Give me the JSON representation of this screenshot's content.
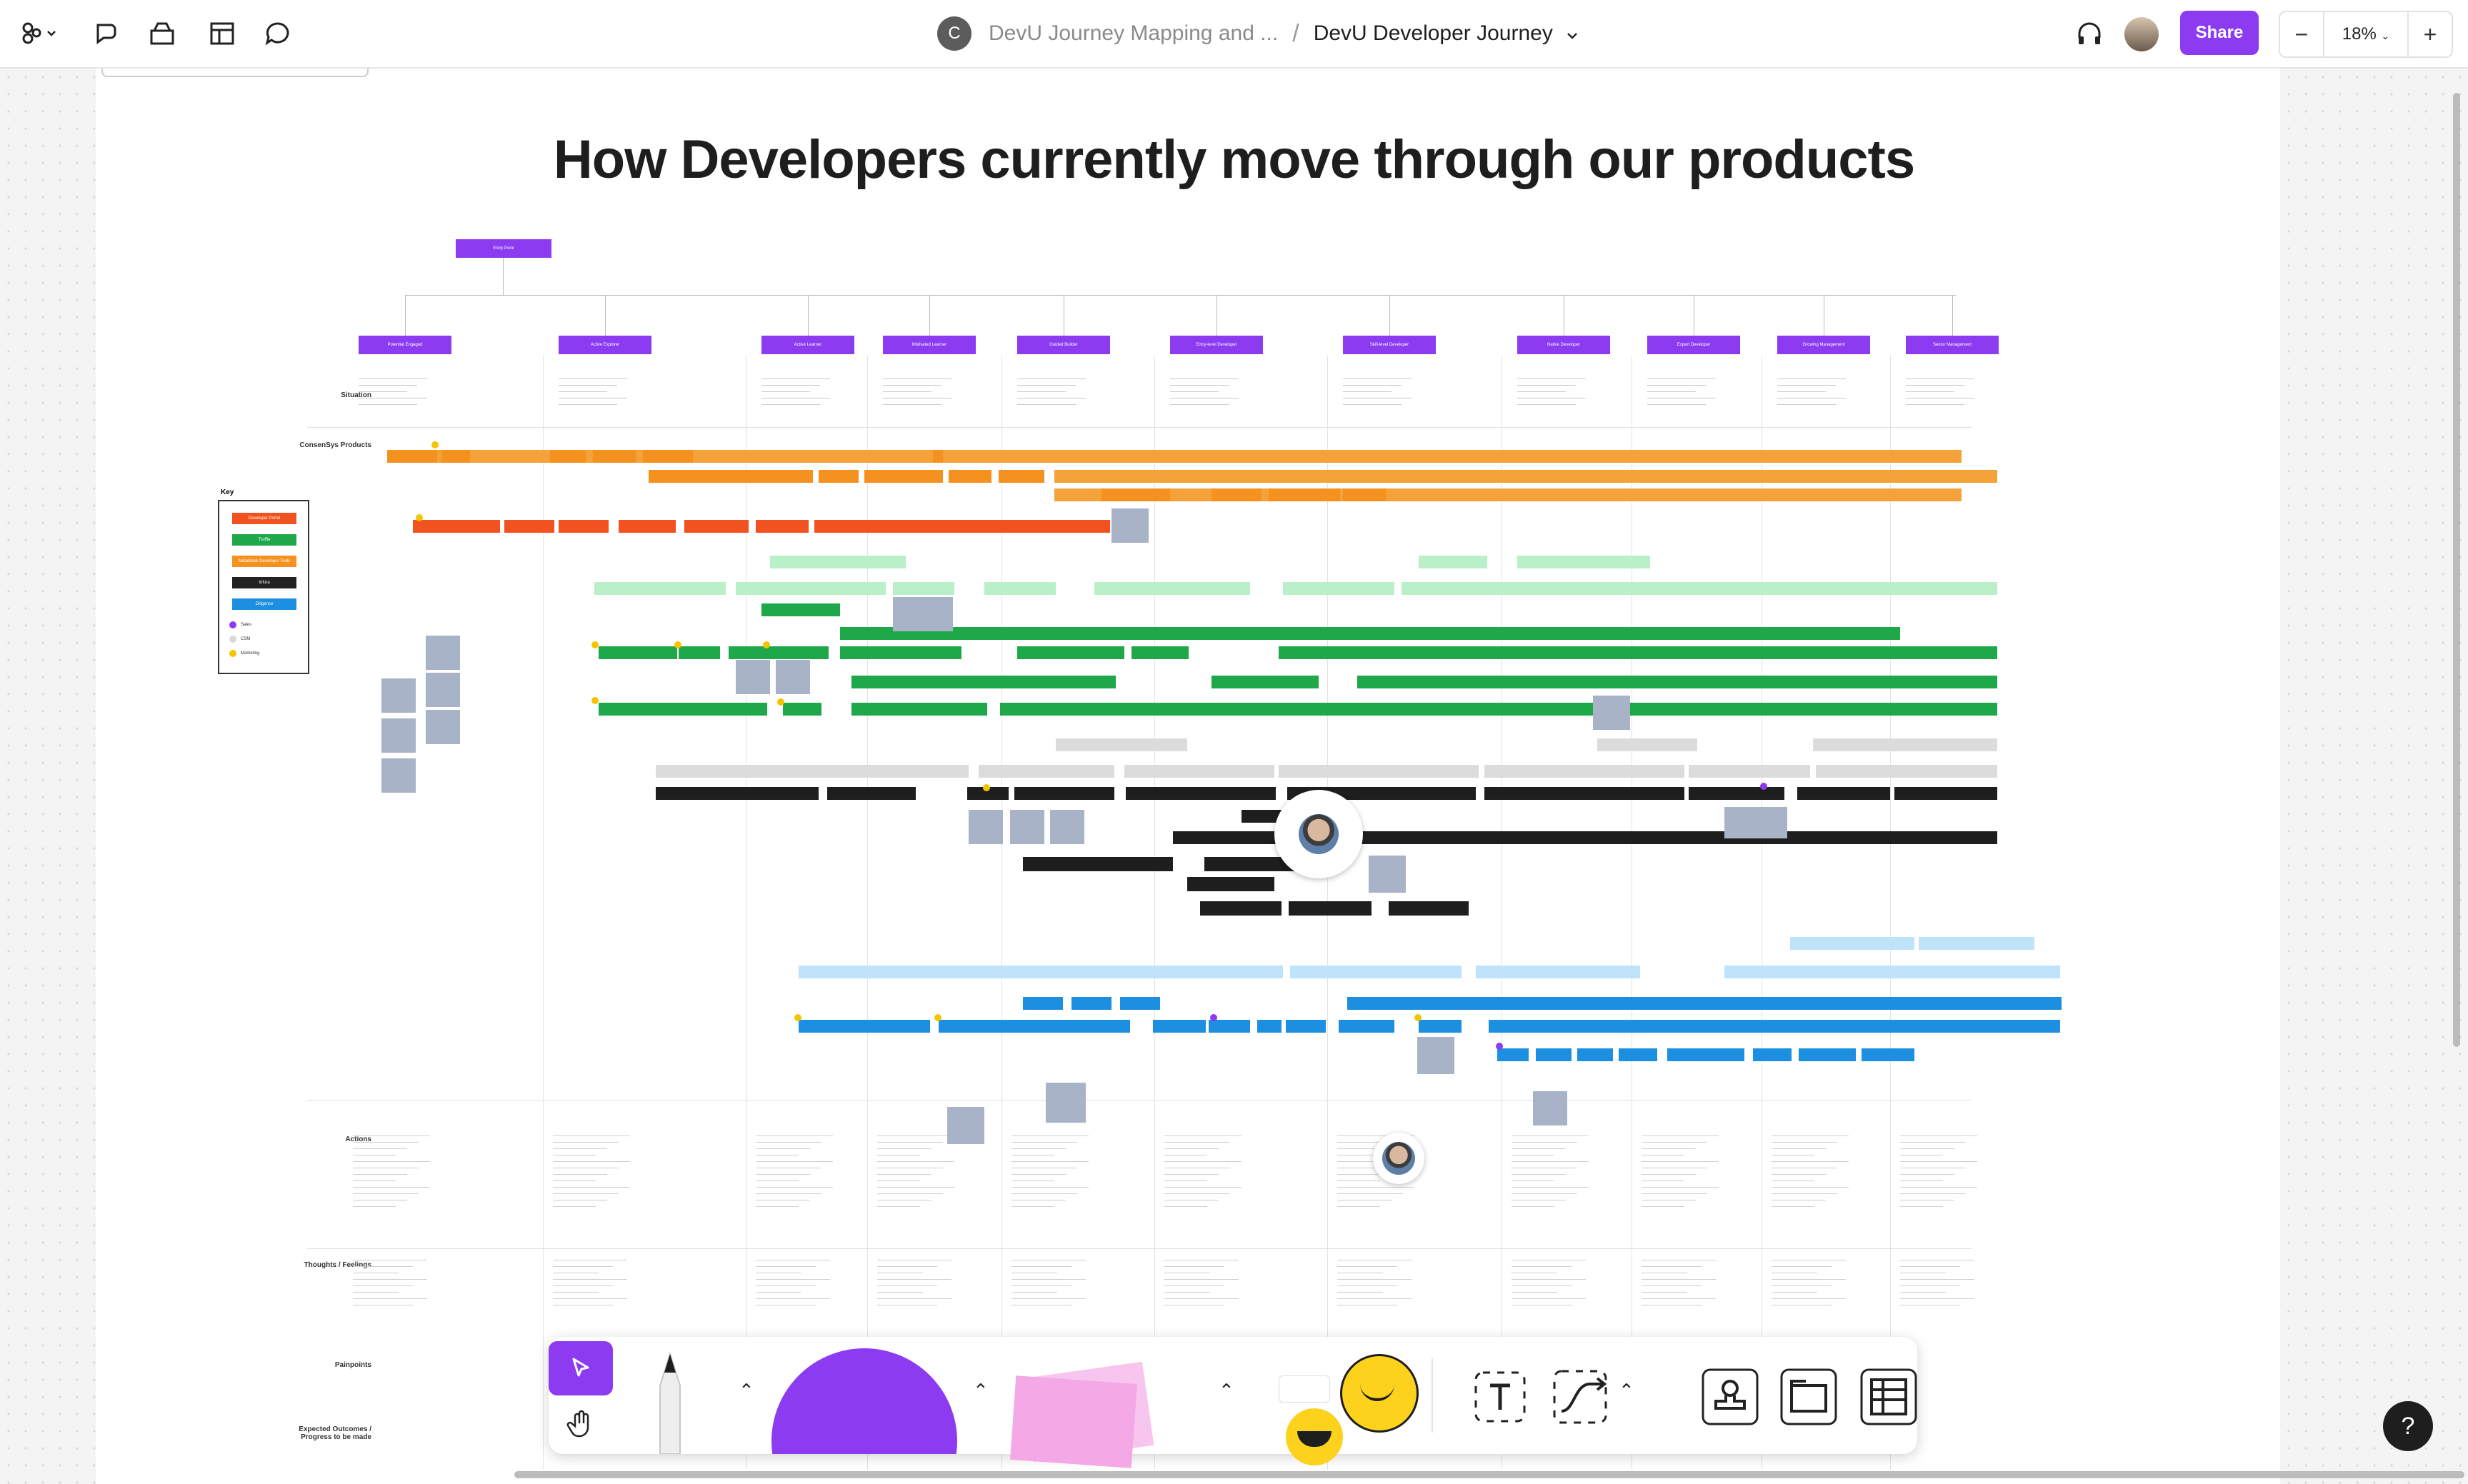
{
  "app": {
    "board_owner_initial": "C",
    "project_name": "DevU Journey Mapping and ...",
    "board_title": "DevU Developer Journey",
    "share_label": "Share",
    "zoom": "18%",
    "zoom_out": "−",
    "zoom_in": "+",
    "help": "?"
  },
  "board": {
    "title": "How Developers currently move through our products",
    "root_node": "Entry Point",
    "stages": [
      "Potential Engaged",
      "Active Explorer",
      "Active Learner",
      "Motivated Learner",
      "Guided Builder",
      "Entry-level Developer",
      "Skill-level Developer",
      "Native Developer",
      "Expert Developer",
      "Growing Management",
      "Senior Management"
    ],
    "lanes": {
      "situation": "Situation",
      "products": "ConsenSys Products",
      "actions": "Actions",
      "thoughts": "Thoughts / Feelings",
      "painpoints": "Painpoints",
      "outcomes": "Expected Outcomes / Progress to be made"
    },
    "key": {
      "title": "Key",
      "items": [
        {
          "label": "Developer Portal",
          "color": "#f2521f"
        },
        {
          "label": "Truffle",
          "color": "#1fa84a"
        },
        {
          "label": "MetaMask Developer Tools",
          "color": "#f5921f"
        },
        {
          "label": "Infura",
          "color": "#222222"
        },
        {
          "label": "Diligence",
          "color": "#1d8fe0"
        }
      ],
      "legend": [
        {
          "label": "Sales",
          "color": "#8c3bf0"
        },
        {
          "label": "CSM",
          "color": "#d9d9d9"
        },
        {
          "label": "Marketing",
          "color": "#f5c400"
        }
      ]
    }
  },
  "icons": {
    "main_menu": "figjam-logo-icon",
    "cursor_chat": "cursor-chat-icon",
    "assets": "assets-icon",
    "layout": "layout-icon",
    "comments": "comment-icon",
    "audio": "headphones-icon",
    "tools": [
      "pointer-icon",
      "hand-icon",
      "marker-icon",
      "shape-icon",
      "sticky-note-icon",
      "sticker-icon",
      "text-icon",
      "connector-icon",
      "stamp-icon",
      "section-icon",
      "table-icon"
    ]
  }
}
